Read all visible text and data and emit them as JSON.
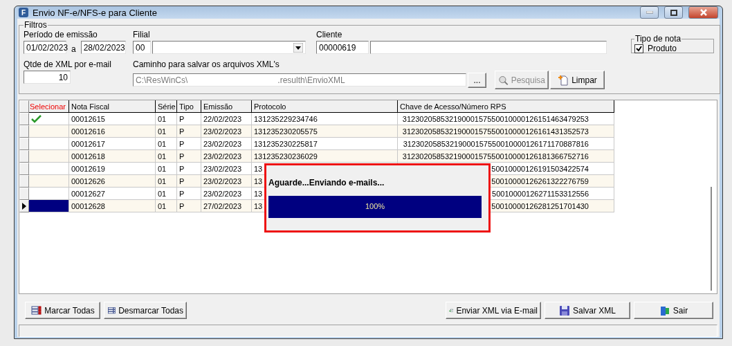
{
  "window": {
    "title": "Envio NF-e/NFS-e para Cliente",
    "app_letter": "F"
  },
  "filters": {
    "legend": "Filtros",
    "period": {
      "label": "Período de emissão",
      "from": "01/02/2023",
      "separator": "a",
      "to": "28/02/2023"
    },
    "branch": {
      "label": "Filial",
      "code": "00"
    },
    "client": {
      "label": "Cliente",
      "code": "00000619"
    },
    "xml_per_email": {
      "label": "Qtde de XML por e-mail",
      "value": "10"
    },
    "path": {
      "label": "Caminho para salvar os arquivos XML's",
      "start": "C:\\ResWinCs\\",
      "end": ".resulth\\EnvioXML"
    },
    "browse_button": "...",
    "search_button": {
      "label": "Pesquisa",
      "disabled": true
    },
    "clear_button": {
      "label": "Limpar",
      "disabled": false
    },
    "note_type": {
      "legend": "Tipo de nota",
      "option": "Produto",
      "checked": true
    }
  },
  "table": {
    "select_column": "Selecionar",
    "columns": [
      "Nota Fiscal",
      "Série",
      "Tipo",
      "Emissão",
      "Protocolo",
      "Chave de Acesso/Número RPS"
    ],
    "rows": [
      {
        "selected": false,
        "checked": true,
        "cells": [
          "00012615",
          "01",
          "P",
          "22/02/2023",
          "131235229234746",
          "31230205853219000157550010000126151463479253"
        ]
      },
      {
        "selected": false,
        "checked": false,
        "cells": [
          "00012616",
          "01",
          "P",
          "23/02/2023",
          "131235230205575",
          "31230205853219000157550010000126161431352573"
        ]
      },
      {
        "selected": false,
        "checked": false,
        "cells": [
          "00012617",
          "01",
          "P",
          "23/02/2023",
          "131235230225817",
          "31230205853219000157550010000126171170887816"
        ]
      },
      {
        "selected": false,
        "checked": false,
        "cells": [
          "00012618",
          "01",
          "P",
          "23/02/2023",
          "131235230236029",
          "31230205853219000157550010000126181366752716"
        ]
      },
      {
        "selected": false,
        "checked": false,
        "cells": [
          "00012619",
          "01",
          "P",
          "23/02/2023",
          "13",
          "50010000126191503422574"
        ]
      },
      {
        "selected": false,
        "checked": false,
        "cells": [
          "00012626",
          "01",
          "P",
          "23/02/2023",
          "13",
          "50010000126261322276759"
        ]
      },
      {
        "selected": false,
        "checked": false,
        "cells": [
          "00012627",
          "01",
          "P",
          "23/02/2023",
          "13",
          "50010000126271153312556"
        ]
      },
      {
        "selected": true,
        "checked": false,
        "cells": [
          "00012628",
          "01",
          "P",
          "27/02/2023",
          "13",
          "50010000126281251701430"
        ]
      }
    ]
  },
  "dialog": {
    "message": "Aguarde...Enviando e-mails...",
    "progress": {
      "level": 1,
      "reading": "100%"
    }
  },
  "buttons_left": [
    "Marcar Todas",
    "Desmarcar Todas"
  ],
  "buttons_right": [
    "Enviar XML via E-mail",
    "Salvar XML",
    "Sair"
  ]
}
